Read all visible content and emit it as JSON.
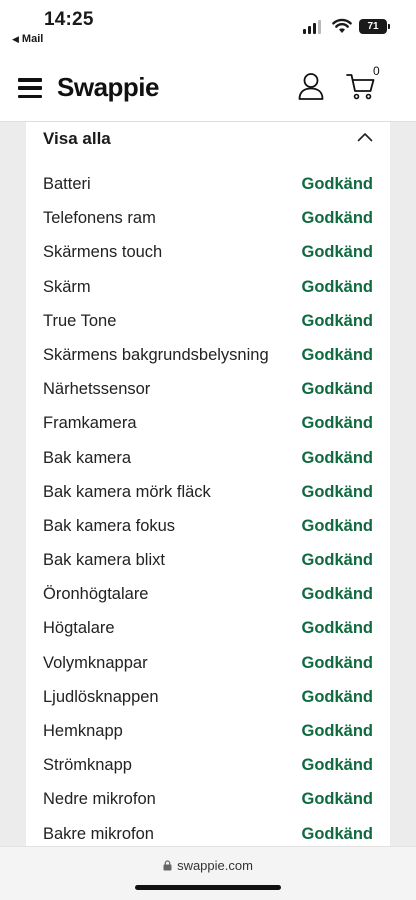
{
  "status_bar": {
    "time": "14:25",
    "back_app": "Mail",
    "battery": "71"
  },
  "header": {
    "logo": "Swappie",
    "cart_count": "0"
  },
  "section": {
    "title": "Visa alla",
    "rows": [
      {
        "label": "Batteri",
        "status": "Godkänd"
      },
      {
        "label": "Telefonens ram",
        "status": "Godkänd"
      },
      {
        "label": "Skärmens touch",
        "status": "Godkänd"
      },
      {
        "label": "Skärm",
        "status": "Godkänd"
      },
      {
        "label": "True Tone",
        "status": "Godkänd"
      },
      {
        "label": "Skärmens bakgrundsbelysning",
        "status": "Godkänd"
      },
      {
        "label": "Närhetssensor",
        "status": "Godkänd"
      },
      {
        "label": "Framkamera",
        "status": "Godkänd"
      },
      {
        "label": "Bak kamera",
        "status": "Godkänd"
      },
      {
        "label": "Bak kamera mörk fläck",
        "status": "Godkänd"
      },
      {
        "label": "Bak kamera fokus",
        "status": "Godkänd"
      },
      {
        "label": "Bak kamera blixt",
        "status": "Godkänd"
      },
      {
        "label": "Öronhögtalare",
        "status": "Godkänd"
      },
      {
        "label": "Högtalare",
        "status": "Godkänd"
      },
      {
        "label": "Volymknappar",
        "status": "Godkänd"
      },
      {
        "label": "Ljudlösknappen",
        "status": "Godkänd"
      },
      {
        "label": "Hemknapp",
        "status": "Godkänd"
      },
      {
        "label": "Strömknapp",
        "status": "Godkänd"
      },
      {
        "label": "Nedre mikrofon",
        "status": "Godkänd"
      },
      {
        "label": "Bakre mikrofon",
        "status": "Godkänd"
      }
    ]
  },
  "browser": {
    "url": "swappie.com"
  },
  "colors": {
    "status_green": "#0f6a3f",
    "page_background": "#ececec"
  },
  "icons": {
    "menu": "hamburger-icon",
    "account": "user-icon",
    "cart": "cart-icon",
    "collapse": "chevron-up-icon",
    "lock": "lock-icon"
  }
}
